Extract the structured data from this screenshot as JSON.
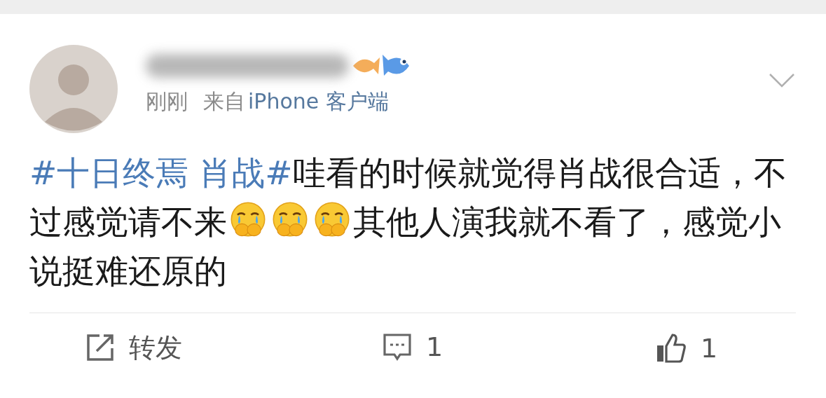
{
  "post": {
    "time": "刚刚",
    "source_prefix": "来自",
    "source": "iPhone 客户端",
    "body": [
      {
        "kind": "hashtag",
        "text": "#十日终焉 肖战#"
      },
      {
        "kind": "text",
        "text": "哇看的时候就觉得肖战很合适，不过感觉请不来"
      },
      {
        "kind": "emoji"
      },
      {
        "kind": "emoji"
      },
      {
        "kind": "emoji"
      },
      {
        "kind": "text",
        "text": "其他人演我就不看了，感觉小说挺难还原的"
      }
    ]
  },
  "actions": [
    {
      "kind": "repost",
      "label": "转发"
    },
    {
      "kind": "comment",
      "label": "1"
    },
    {
      "kind": "like",
      "label": "1"
    }
  ]
}
